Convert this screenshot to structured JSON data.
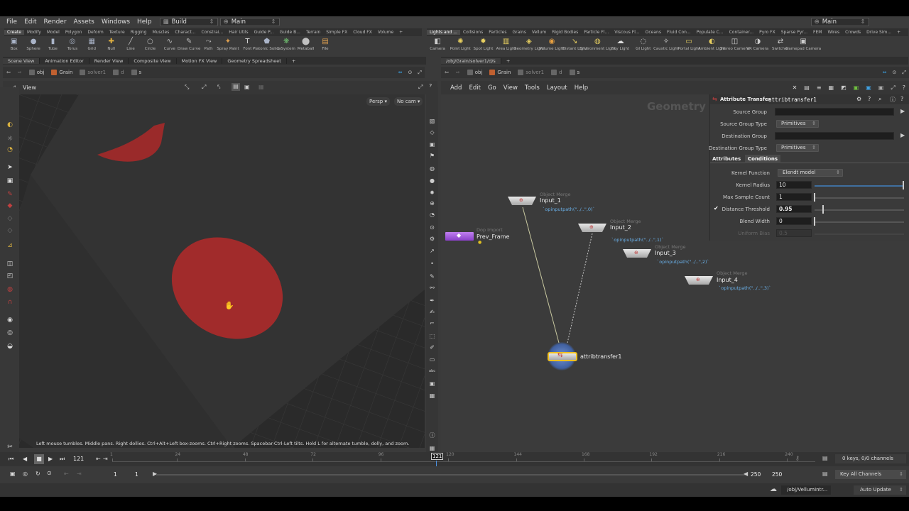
{
  "menu": [
    "File",
    "Edit",
    "Render",
    "Assets",
    "Windows",
    "Help"
  ],
  "desktop": {
    "build": "Build",
    "main": "Main",
    "title_right": "Main"
  },
  "shelf_left": {
    "tabs": [
      "Create",
      "Modify",
      "Model",
      "Polygon",
      "Deform",
      "Texture",
      "Rigging",
      "Muscles",
      "Charact...",
      "Constrai...",
      "Hair Utils",
      "Guide P...",
      "Guide B...",
      "Terrain",
      "Simple FX",
      "Cloud FX",
      "Volume"
    ],
    "tools": [
      {
        "label": "Box",
        "icon": "box-icon",
        "glyph": "▣",
        "color": "#aab4c8"
      },
      {
        "label": "Sphere",
        "icon": "sphere-icon",
        "glyph": "●",
        "color": "#aab4c8"
      },
      {
        "label": "Tube",
        "icon": "tube-icon",
        "glyph": "▮",
        "color": "#aab4c8"
      },
      {
        "label": "Torus",
        "icon": "torus-icon",
        "glyph": "◎",
        "color": "#aab4c8"
      },
      {
        "label": "Grid",
        "icon": "grid-icon",
        "glyph": "▦",
        "color": "#aab4c8"
      },
      {
        "label": "Null",
        "icon": "null-icon",
        "glyph": "✚",
        "color": "#e0b040"
      },
      {
        "label": "Line",
        "icon": "line-icon",
        "glyph": "╱",
        "color": "#bbbbbb"
      },
      {
        "label": "Circle",
        "icon": "circle-icon",
        "glyph": "○",
        "color": "#bbbbbb"
      },
      {
        "label": "Curve",
        "icon": "curve-icon",
        "glyph": "∿",
        "color": "#bbbbbb"
      },
      {
        "label": "Draw Curve",
        "icon": "draw-curve-icon",
        "glyph": "✎",
        "color": "#bbbbbb"
      },
      {
        "label": "Path",
        "icon": "path-icon",
        "glyph": "⤳",
        "color": "#bbbbbb"
      },
      {
        "label": "Spray Paint",
        "icon": "spray-paint-icon",
        "glyph": "✦",
        "color": "#e0a050"
      },
      {
        "label": "Font",
        "icon": "font-icon",
        "glyph": "T",
        "color": "#dddddd"
      },
      {
        "label": "Platonic Solids",
        "icon": "platonic-icon",
        "glyph": "⬟",
        "color": "#aab4c8"
      },
      {
        "label": "L-System",
        "icon": "lsystem-icon",
        "glyph": "❋",
        "color": "#70c070"
      },
      {
        "label": "Metaball",
        "icon": "metaball-icon",
        "glyph": "⬤",
        "color": "#c0c0c0"
      },
      {
        "label": "File",
        "icon": "file-icon",
        "glyph": "▤",
        "color": "#e0a050"
      }
    ]
  },
  "shelf_right": {
    "tabs": [
      "Lights and ...",
      "Collisions",
      "Particles",
      "Grains",
      "Vellum",
      "Rigid Bodies",
      "Particle Fl...",
      "Viscous Fl...",
      "Oceans",
      "Fluid Con...",
      "Populate C...",
      "Container...",
      "Pyro FX",
      "Sparse Pyr...",
      "FEM",
      "Wires",
      "Crowds",
      "Drive Sim..."
    ],
    "tools": [
      {
        "label": "Camera",
        "icon": "camera-icon",
        "glyph": "◧",
        "color": "#cccccc"
      },
      {
        "label": "Point Light",
        "icon": "point-light-icon",
        "glyph": "✺",
        "color": "#e8d060"
      },
      {
        "label": "Spot Light",
        "icon": "spot-light-icon",
        "glyph": "✹",
        "color": "#e8d060"
      },
      {
        "label": "Area Light",
        "icon": "area-light-icon",
        "glyph": "▥",
        "color": "#e8d060"
      },
      {
        "label": "Geometry Light",
        "icon": "geometry-light-icon",
        "glyph": "◈",
        "color": "#e8d060"
      },
      {
        "label": "Volume Light",
        "icon": "volume-light-icon",
        "glyph": "◉",
        "color": "#e8a040"
      },
      {
        "label": "Distant Light",
        "icon": "distant-light-icon",
        "glyph": "↘",
        "color": "#e8d060"
      },
      {
        "label": "Environment Light",
        "icon": "environment-light-icon",
        "glyph": "◍",
        "color": "#e8d060"
      },
      {
        "label": "Sky Light",
        "icon": "sky-light-icon",
        "glyph": "☁",
        "color": "#dddddd"
      },
      {
        "label": "GI Light",
        "icon": "gi-light-icon",
        "glyph": "◌",
        "color": "#dddddd"
      },
      {
        "label": "Caustic Light",
        "icon": "caustic-light-icon",
        "glyph": "✧",
        "color": "#dddddd"
      },
      {
        "label": "Portal Light",
        "icon": "portal-light-icon",
        "glyph": "▭",
        "color": "#e8d060"
      },
      {
        "label": "Ambient Light",
        "icon": "ambient-light-icon",
        "glyph": "◐",
        "color": "#e8d060"
      },
      {
        "label": "Stereo Camera",
        "icon": "stereo-camera-icon",
        "glyph": "◫",
        "color": "#cccccc"
      },
      {
        "label": "VR Camera",
        "icon": "vr-camera-icon",
        "glyph": "◑",
        "color": "#cccccc"
      },
      {
        "label": "Switcher",
        "icon": "switcher-icon",
        "glyph": "⇄",
        "color": "#cccccc"
      },
      {
        "label": "Gamepad Camera",
        "icon": "gamepad-camera-icon",
        "glyph": "▣",
        "color": "#cccccc"
      }
    ]
  },
  "pane_tabs_left": [
    "Scene View",
    "Animation Editor",
    "Render View",
    "Composite View",
    "Motion FX View",
    "Geometry Spreadsheet"
  ],
  "pane_tab_right": "/obj/Grain/solver1/d/s",
  "path_left": [
    "obj",
    "Grain",
    "solver1",
    "d",
    "s"
  ],
  "path_right": [
    "obj",
    "Grain",
    "solver1",
    "d",
    "s"
  ],
  "viewport": {
    "label": "View",
    "persp": "Persp",
    "cam": "No cam",
    "hint": "Left mouse tumbles. Middle pans. Right dollies. Ctrl+Alt+Left box-zooms. Ctrl+Right zooms. Spacebar-Ctrl-Left tilts. Hold L for alternate tumble, dolly, and zoom."
  },
  "network": {
    "menu": [
      "Add",
      "Edit",
      "Go",
      "View",
      "Tools",
      "Layout",
      "Help"
    ],
    "context_label": "Geometry",
    "nodes": [
      {
        "type": "Object Merge",
        "name": "Input_1",
        "expr": "`opinputpath(\"../..\",0)`"
      },
      {
        "type": "Object Merge",
        "name": "Input_2",
        "expr": "`opinputpath(\"../..\",1)`"
      },
      {
        "type": "Object Merge",
        "name": "Input_3",
        "expr": "`opinputpath(\"../..\",2)`"
      },
      {
        "type": "Object Merge",
        "name": "Input_4",
        "expr": "`opinputpath(\"../..\",3)`"
      },
      {
        "type": "Dop Import",
        "name": "Prev_Frame"
      },
      {
        "type": "",
        "name": "attribtransfer1"
      }
    ]
  },
  "params": {
    "node_type": "Attribute Transfer",
    "node_name": "attribtransfer1",
    "source_group": "Source Group",
    "source_group_type": "Source Group Type",
    "source_group_type_value": "Primitives",
    "dest_group": "Destination Group",
    "dest_group_type": "Destination Group Type",
    "dest_group_type_value": "Primitives",
    "tab_attributes": "Attributes",
    "tab_conditions": "Conditions",
    "kernel_function": "Kernel Function",
    "kernel_function_value": "Elendt model",
    "kernel_radius": "Kernel Radius",
    "kernel_radius_value": "10",
    "max_sample": "Max Sample Count",
    "max_sample_value": "1",
    "distance_threshold": "Distance Threshold",
    "distance_threshold_value": "0.95",
    "blend_width": "Blend Width",
    "blend_width_value": "0",
    "uniform_bias": "Uniform Bias",
    "uniform_bias_value": "0.5"
  },
  "timeline": {
    "frame": "121",
    "marker": "121",
    "ticks": [
      "1",
      "24",
      "48",
      "72",
      "96",
      "120",
      "144",
      "168",
      "192",
      "216",
      "240"
    ],
    "start": "1",
    "start2": "1",
    "end": "250",
    "end2": "250",
    "keys": "0 keys, 0/0 channels",
    "key_all": "Key All Channels"
  },
  "status": {
    "path": "/obj/VellumIntr...",
    "update": "Auto Update"
  }
}
